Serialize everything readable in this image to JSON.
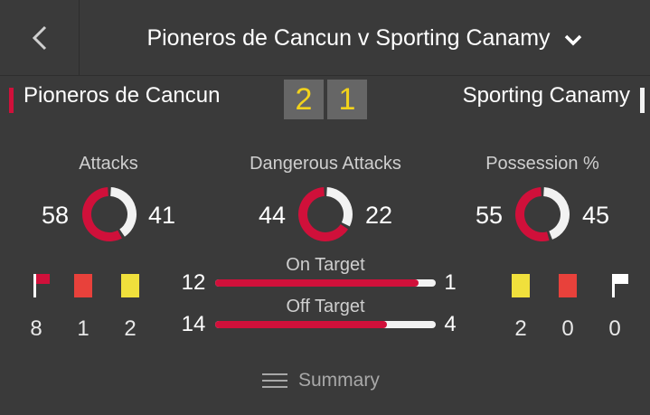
{
  "header": {
    "title": "Pioneros de Cancun v Sporting Canamy",
    "back_icon": "chevron-left-icon",
    "dropdown_icon": "chevron-down-icon"
  },
  "match": {
    "home_team": "Pioneros de Cancun",
    "away_team": "Sporting Canamy",
    "home_score": "2",
    "away_score": "1",
    "home_color": "#d0103a",
    "away_color": "#f2f2f2",
    "score_color": "#f2d21b"
  },
  "stats": {
    "attacks": {
      "label": "Attacks",
      "home": "58",
      "away": "41"
    },
    "dangerous": {
      "label": "Dangerous Attacks",
      "home": "44",
      "away": "22"
    },
    "possession": {
      "label": "Possession %",
      "home": "55",
      "away": "45"
    }
  },
  "home_cards": {
    "corners": "8",
    "red": "1",
    "yellow": "2"
  },
  "away_cards": {
    "yellow": "2",
    "red": "0",
    "corners": "0"
  },
  "shots": {
    "on_target": {
      "label": "On Target",
      "home": "12",
      "away": "1"
    },
    "off_target": {
      "label": "Off Target",
      "home": "14",
      "away": "4"
    }
  },
  "summary": {
    "label": "Summary",
    "icon": "menu-icon"
  },
  "colors": {
    "red_card": "#e8413b",
    "yellow_card": "#f0e03c",
    "text_muted": "#cfcfcf"
  }
}
